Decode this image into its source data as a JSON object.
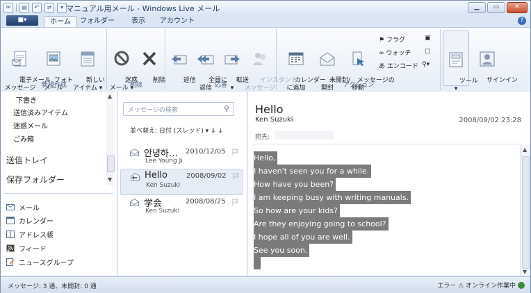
{
  "window": {
    "title": "マニュアル用メール - Windows Live メール"
  },
  "ribbon_tabs": [
    "ホーム",
    "フォルダー",
    "表示",
    "アカウント"
  ],
  "app_button": "■▾",
  "groups": {
    "new": {
      "label": "新規作成",
      "buttons": [
        "電子メール\nメッセージ",
        "フォト\nメール",
        "新しい\nアイテム ▾"
      ]
    },
    "delete": {
      "label": "削除",
      "buttons": [
        "迷惑\nメール ▾",
        "削除"
      ]
    },
    "respond": {
      "label": "応答",
      "buttons": [
        "返信",
        "全員に\n返信",
        "転送\n▾",
        "インスタント\nメッセージ"
      ]
    },
    "actions": {
      "label": "アクション",
      "buttons": [
        "カレンダー\nに追加",
        "未開封/\n開封",
        "メッセージの\n移動"
      ],
      "small": [
        "フラグ",
        "ウォッチ",
        "エンコード"
      ]
    },
    "tools": {
      "buttons": [
        "ツール\n▾",
        "サインイン"
      ]
    }
  },
  "folders": [
    "下書き",
    "送信済みアイテム",
    "迷惑メール",
    "ごみ箱"
  ],
  "big_folders": [
    "送信トレイ",
    "保存フォルダー"
  ],
  "nav": [
    "メール",
    "カレンダー",
    "アドレス帳",
    "フィード",
    "ニュースグループ"
  ],
  "search_placeholder": "メッセージの検索",
  "sort": "並べ替え: 日付 (スレッド) ▾  ⇓ ↓",
  "messages": [
    {
      "subject": "안녕하…",
      "from": "Lee Young Ji",
      "date": "2010/12/05"
    },
    {
      "subject": "Hello",
      "from": "Ken Suzuki",
      "date": "2008/09/02"
    },
    {
      "subject": "学会",
      "from": "Ken Suzuki",
      "date": "2008/08/25"
    }
  ],
  "reading": {
    "subject": "Hello",
    "from": "Ken Suzuki",
    "date": "2008/09/02 23:28",
    "to_label": "宛先:",
    "body": [
      "Hello,",
      "I haven't seen you for a while.",
      "How have you been?",
      "I am keeping busy with writing manuals.",
      "So how are your kids?",
      "Are they enjoying going to school?",
      "I hope all of you are well.",
      "See you soon."
    ]
  },
  "status": {
    "left": "メッセージ: 3 通、未開封: 0 通",
    "right": "エラー ⚠ オンライン作業中"
  },
  "colors": {
    "ribbon_bg": "#e6edf7",
    "selection": "#e6ecf5",
    "body_highlight": "#7b7b7b"
  }
}
